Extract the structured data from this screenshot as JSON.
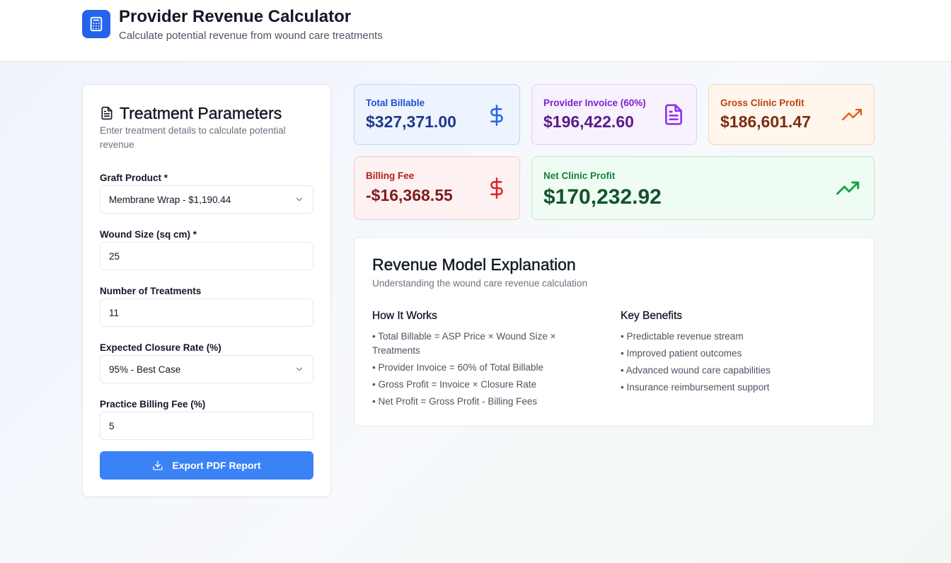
{
  "header": {
    "title": "Provider Revenue Calculator",
    "subtitle": "Calculate potential revenue from wound care treatments",
    "logo_icon": "calculator-icon"
  },
  "parameters": {
    "title": "Treatment Parameters",
    "description": "Enter treatment details to calculate potential revenue",
    "graft_product": {
      "label": "Graft Product *",
      "value": "Membrane Wrap - $1,190.44"
    },
    "wound_size": {
      "label": "Wound Size (sq cm) *",
      "value": "25"
    },
    "treatments": {
      "label": "Number of Treatments",
      "value": "11"
    },
    "closure_rate": {
      "label": "Expected Closure Rate (%)",
      "value": "95% - Best Case"
    },
    "billing_fee": {
      "label": "Practice Billing Fee (%)",
      "value": "5"
    },
    "export_label": "Export PDF Report"
  },
  "stats": {
    "total_billable": {
      "label": "Total Billable",
      "value": "$327,371.00",
      "icon": "dollar-icon",
      "color": "#2563eb"
    },
    "provider_invoice": {
      "label": "Provider Invoice (60%)",
      "value": "$196,422.60",
      "icon": "document-icon",
      "color": "#9333ea"
    },
    "gross_profit": {
      "label": "Gross Clinic Profit",
      "value": "$186,601.47",
      "icon": "trending-up-icon",
      "color": "#ea580c"
    },
    "billing_fee": {
      "label": "Billing Fee",
      "value": "-$16,368.55",
      "icon": "dollar-icon",
      "color": "#dc2626"
    },
    "net_profit": {
      "label": "Net Clinic Profit",
      "value": "$170,232.92",
      "icon": "trending-up-icon",
      "color": "#16a34a"
    }
  },
  "explanation": {
    "title": "Revenue Model Explanation",
    "subtitle": "Understanding the wound care revenue calculation",
    "how_title": "How It Works",
    "how_items": [
      "• Total Billable = ASP Price × Wound Size × Treatments",
      "• Provider Invoice = 60% of Total Billable",
      "• Gross Profit = Invoice × Closure Rate",
      "• Net Profit = Gross Profit - Billing Fees"
    ],
    "benefits_title": "Key Benefits",
    "benefits_items": [
      "• Predictable revenue stream",
      "• Improved patient outcomes",
      "• Advanced wound care capabilities",
      "• Insurance reimbursement support"
    ]
  }
}
